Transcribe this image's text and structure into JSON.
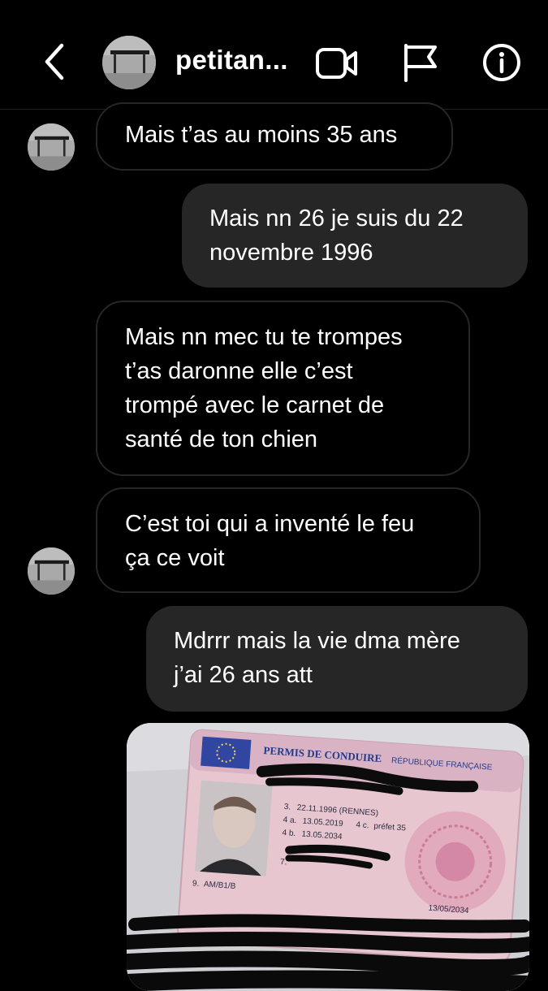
{
  "header": {
    "contact_name": "petitan...",
    "icons": {
      "back": "chevron-left-icon",
      "video": "video-camera-icon",
      "report": "flag-icon",
      "info": "info-icon"
    }
  },
  "messages": [
    {
      "direction": "incoming",
      "text": "Mais t’as au moins 35 ans"
    },
    {
      "direction": "outgoing",
      "lines": [
        "Mais nn 26 je suis du 22",
        "novembre 1996"
      ]
    },
    {
      "direction": "incoming",
      "lines": [
        "Mais nn mec tu te trompes",
        "t’as daronne elle c’est",
        "trompé avec le carnet de",
        "santé de ton chien"
      ]
    },
    {
      "direction": "incoming",
      "lines": [
        "C’est toi qui a inventé le feu",
        "ça ce voit"
      ]
    },
    {
      "direction": "outgoing",
      "lines": [
        "Mdrrr mais la vie dma mère",
        "j’ai 26 ans att"
      ]
    }
  ],
  "photo": {
    "card_title": "PERMIS DE CONDUIRE",
    "card_country": "RÉPUBLIQUE FRANÇAISE",
    "field_3": "3.",
    "birth": "22.11.1996 (RENNES)",
    "field_4a": "4 a.",
    "issued": "13.05.2019",
    "field_4c": "4 c.",
    "authority": "préfet 35",
    "field_4b": "4 b.",
    "expires": "13.05.2034",
    "field_9": "9.",
    "categories": "AM/B1/B",
    "field_7": "7.",
    "stamp_date": "13/05/2034"
  },
  "colors": {
    "background": "#000000",
    "bubble_outgoing": "#262626",
    "bubble_incoming_border": "#262626",
    "text": "#ffffff"
  }
}
